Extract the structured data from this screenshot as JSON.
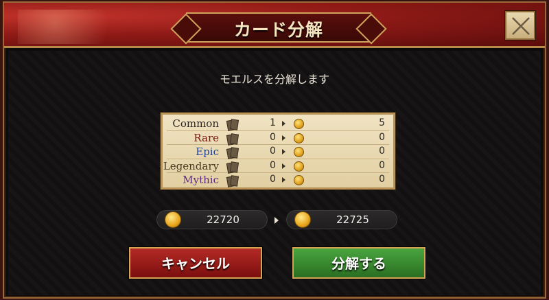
{
  "dialog": {
    "title": "カード分解",
    "subtitle": "モエルスを分解します"
  },
  "table": {
    "rows": [
      {
        "rarity": "Common",
        "count": "1",
        "result": "5",
        "color": "#2b2620"
      },
      {
        "rarity": "Rare",
        "count": "0",
        "result": "0",
        "color": "#7a1410"
      },
      {
        "rarity": "Epic",
        "count": "0",
        "result": "0",
        "color": "#1f3f8a"
      },
      {
        "rarity": "Legendary",
        "count": "0",
        "result": "0",
        "color": "#4a3b22"
      },
      {
        "rarity": "Mythic",
        "count": "0",
        "result": "0",
        "color": "#5b2a7a"
      }
    ]
  },
  "coins": {
    "current": "22720",
    "after": "22725"
  },
  "buttons": {
    "cancel_label": "キャンセル",
    "confirm_label": "分解する"
  },
  "icons": {
    "close": "close-icon",
    "coin": "coin-icon",
    "card": "card-icon",
    "arrow": "arrow-right-icon"
  }
}
